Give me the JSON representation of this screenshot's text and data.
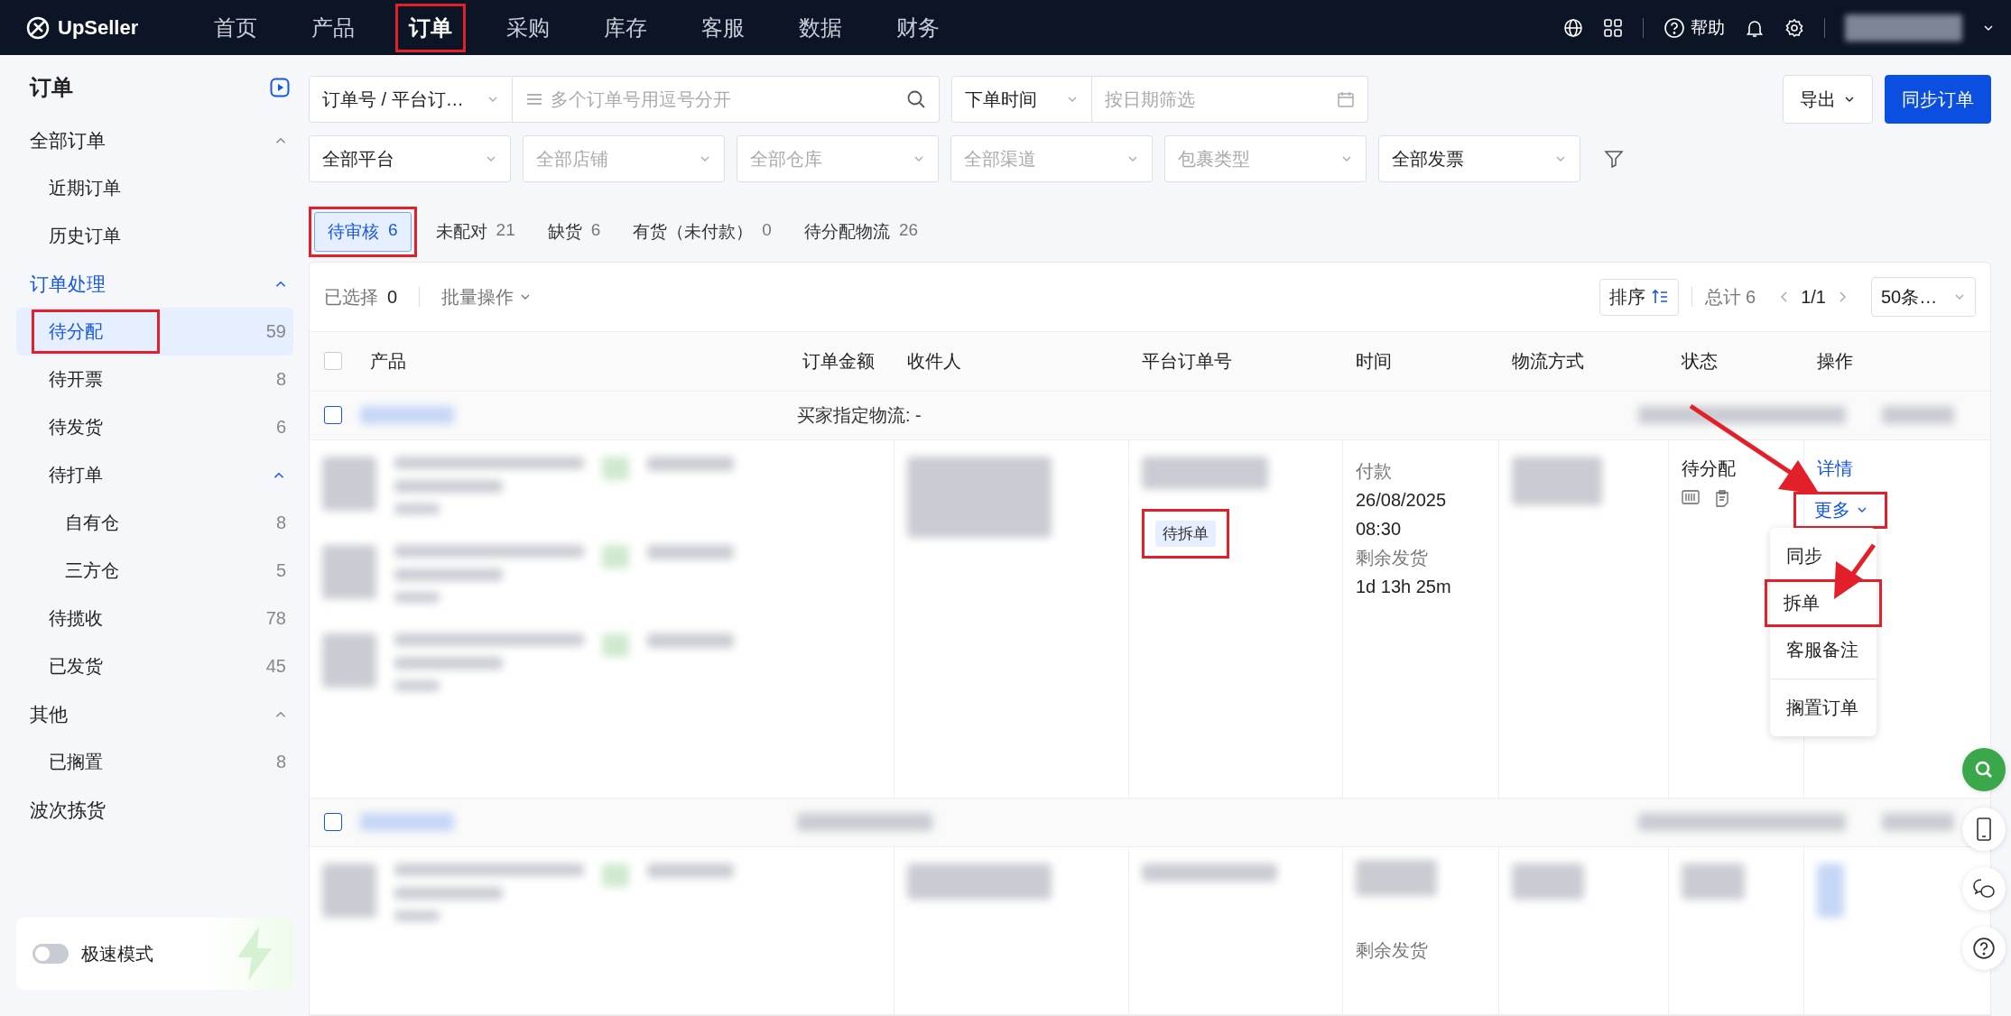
{
  "top_nav": {
    "logo": "UpSeller",
    "items": [
      {
        "label": "首页",
        "selected": false
      },
      {
        "label": "产品",
        "selected": false
      },
      {
        "label": "订单",
        "selected": true,
        "annotated": true
      },
      {
        "label": "采购",
        "selected": false
      },
      {
        "label": "库存",
        "selected": false
      },
      {
        "label": "客服",
        "selected": false
      },
      {
        "label": "数据",
        "selected": false
      },
      {
        "label": "财务",
        "selected": false
      }
    ],
    "help": "帮助"
  },
  "sidebar": {
    "title": "订单",
    "groups": [
      {
        "label": "全部订单",
        "active": false,
        "expanded": true,
        "items": [
          {
            "label": "近期订单",
            "selected": false
          },
          {
            "label": "历史订单",
            "selected": false
          }
        ]
      },
      {
        "label": "订单处理",
        "active": true,
        "expanded": true,
        "items": [
          {
            "label": "待分配",
            "count": "59",
            "selected": true,
            "annotated": true
          },
          {
            "label": "待开票",
            "count": "8",
            "selected": false
          },
          {
            "label": "待发货",
            "count": "6",
            "selected": false
          },
          {
            "label": "待打单",
            "selected": false,
            "expanded": true,
            "children": [
              {
                "label": "自有仓",
                "count": "8",
                "selected": false
              },
              {
                "label": "三方仓",
                "count": "5",
                "selected": false
              }
            ]
          },
          {
            "label": "待揽收",
            "count": "78",
            "selected": false
          },
          {
            "label": "已发货",
            "count": "45",
            "selected": false
          }
        ]
      },
      {
        "label": "其他",
        "active": false,
        "expanded": true,
        "items": [
          {
            "label": "已搁置",
            "count": "8",
            "selected": false
          }
        ]
      },
      {
        "label": "波次拣货",
        "active": false
      }
    ],
    "speed_mode": {
      "label": "极速模式",
      "on": false
    }
  },
  "filters": {
    "search_type": {
      "value": "订单号 / 平台订…"
    },
    "search": {
      "placeholder": "多个订单号用逗号分开"
    },
    "time_type": {
      "value": "下单时间"
    },
    "date": {
      "placeholder": "按日期筛选"
    },
    "export_button": "导出",
    "sync_button": "同步订单",
    "selects": [
      {
        "value": "全部平台"
      },
      {
        "placeholder": "全部店铺"
      },
      {
        "placeholder": "全部仓库"
      },
      {
        "placeholder": "全部渠道"
      },
      {
        "placeholder": "包裹类型"
      },
      {
        "value": "全部发票"
      }
    ]
  },
  "tabs": [
    {
      "label": "待审核",
      "count": "6",
      "selected": true,
      "annotated": true
    },
    {
      "label": "未配对",
      "count": "21",
      "selected": false
    },
    {
      "label": "缺货",
      "count": "6",
      "selected": false
    },
    {
      "label": "有货（未付款）",
      "count": "0",
      "selected": false
    },
    {
      "label": "待分配物流",
      "count": "26",
      "selected": false
    }
  ],
  "toolbar": {
    "selected_label": "已选择",
    "selected_count": "0",
    "batch": "批量操作",
    "sort": "排序",
    "total": "总计 6",
    "page": "1/1",
    "page_size": "50条…"
  },
  "table": {
    "select_all_checked": false,
    "columns": [
      "产品",
      "订单金额",
      "收件人",
      "平台订单号",
      "时间",
      "物流方式",
      "状态",
      "操作"
    ],
    "orders": [
      {
        "checked": false,
        "logistics_note": "买家指定物流: -",
        "tag": {
          "label": "待拆单",
          "annotated": true
        },
        "paid_label": "付款",
        "paid_time": "26/08/2025 08:30",
        "remaining_label": "剩余发货",
        "remaining": "1d 13h 25m",
        "status": "待分配",
        "actions": [
          {
            "label": "详情",
            "kind": "link"
          },
          {
            "label": "更多",
            "kind": "dropdown",
            "annotated": true
          }
        ],
        "menu": [
          {
            "label": "同步"
          },
          {
            "label": "拆单",
            "annotated": true
          },
          {
            "label": "客服备注"
          },
          {
            "label": "搁置订单",
            "divider_before": true
          }
        ]
      },
      {
        "checked": false,
        "remaining_label": "剩余发货"
      }
    ]
  }
}
